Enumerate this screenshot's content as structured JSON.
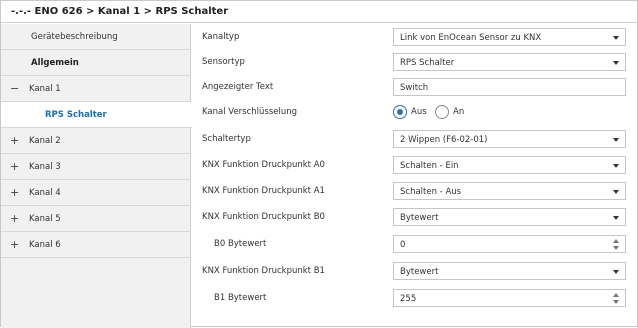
{
  "header": {
    "breadcrumb": "-.-.- ENO 626 > Kanal 1 > RPS Schalter"
  },
  "sidebar": {
    "items": [
      {
        "prefix": "",
        "label": "Gerätebeschreibung"
      },
      {
        "prefix": "",
        "label": "Allgemein"
      },
      {
        "prefix": "−",
        "label": "Kanal 1"
      },
      {
        "prefix": "",
        "label": "RPS Schalter"
      },
      {
        "prefix": "+",
        "label": "Kanal 2"
      },
      {
        "prefix": "+",
        "label": "Kanal 3"
      },
      {
        "prefix": "+",
        "label": "Kanal 4"
      },
      {
        "prefix": "+",
        "label": "Kanal 5"
      },
      {
        "prefix": "+",
        "label": "Kanal 6"
      }
    ]
  },
  "params": {
    "kanaltyp": {
      "label": "Kanaltyp",
      "value": "Link von EnOcean Sensor zu KNX"
    },
    "sensortyp": {
      "label": "Sensortyp",
      "value": "RPS Schalter"
    },
    "angezeigter_text": {
      "label": "Angezeigter Text",
      "value": "Switch"
    },
    "verschluesselung": {
      "label": "Kanal Verschlüsselung",
      "option_aus": "Aus",
      "option_an": "An",
      "selected": "Aus"
    },
    "schaltertyp": {
      "label": "Schaltertyp",
      "value": "2 Wippen (F6-02-01)"
    },
    "funktion_a0": {
      "label": "KNX Funktion Druckpunkt A0",
      "value": "Schalten - Ein"
    },
    "funktion_a1": {
      "label": "KNX Funktion Druckpunkt A1",
      "value": "Schalten - Aus"
    },
    "funktion_b0": {
      "label": "KNX Funktion Druckpunkt B0",
      "value": "Bytewert"
    },
    "b0_bytewert": {
      "label": "B0 Bytewert",
      "value": "0"
    },
    "funktion_b1": {
      "label": "KNX Funktion Druckpunkt B1",
      "value": "Bytewert"
    },
    "b1_bytewert": {
      "label": "B1 Bytewert",
      "value": "255"
    }
  }
}
